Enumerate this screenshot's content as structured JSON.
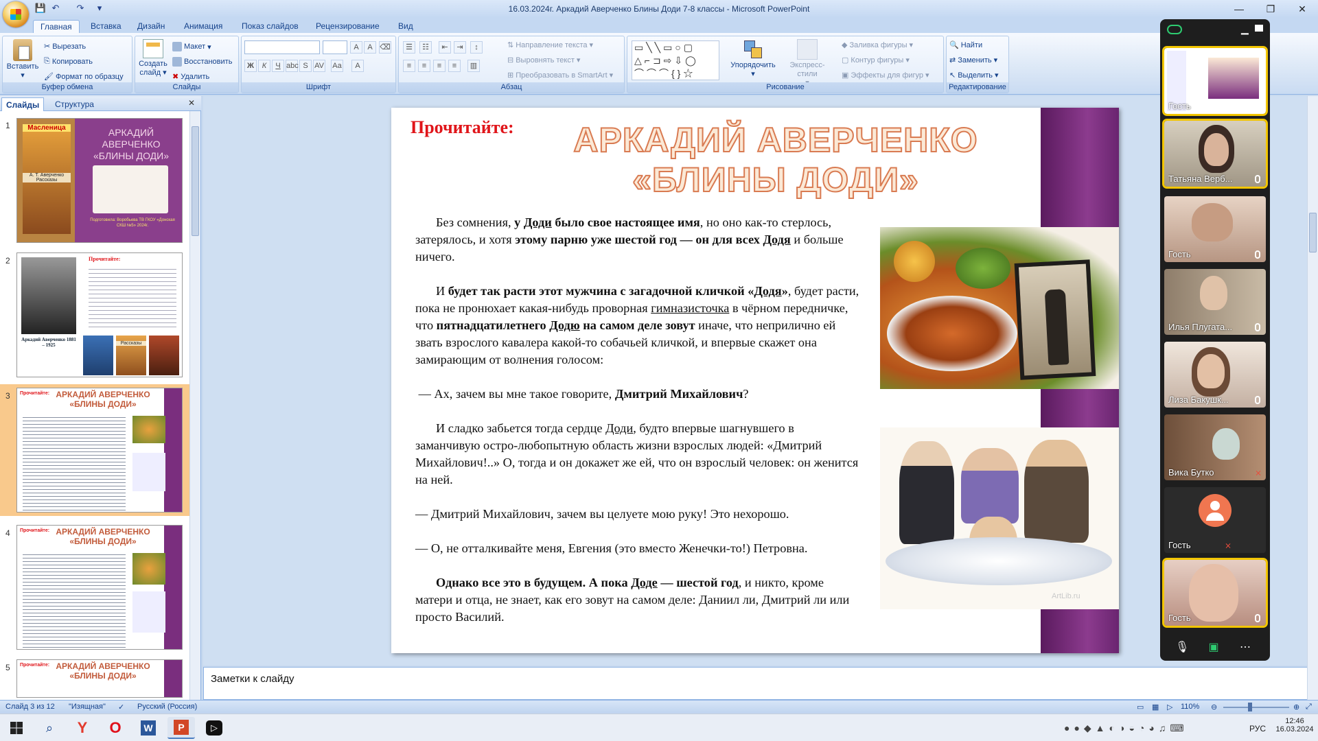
{
  "window": {
    "title": "16.03.2024г. Аркадий Аверченко Блины Доди 7-8 классы - Microsoft PowerPoint"
  },
  "ribbon_tabs": [
    "Главная",
    "Вставка",
    "Дизайн",
    "Анимация",
    "Показ слайдов",
    "Рецензирование",
    "Вид"
  ],
  "clipboard": {
    "paste": "Вставить",
    "cut": "Вырезать",
    "copy": "Копировать",
    "format": "Формат по образцу",
    "label": "Буфер обмена"
  },
  "slides_group": {
    "create": "Создать слайд",
    "layout": "Макет",
    "reset": "Восстановить",
    "delete": "Удалить",
    "label": "Слайды"
  },
  "font_group": {
    "label": "Шрифт"
  },
  "paragraph_group": {
    "direction": "Направление текста",
    "align": "Выровнять текст",
    "smartart": "Преобразовать в SmartArt",
    "label": "Абзац"
  },
  "drawing_group": {
    "arrange": "Упорядочить",
    "quick": "Экспресс-стили",
    "fill": "Заливка фигуры",
    "outline": "Контур фигуры",
    "effects": "Эффекты для фигур",
    "label": "Рисование"
  },
  "editing_group": {
    "find": "Найти",
    "replace": "Заменить",
    "select": "Выделить",
    "label": "Редактирование"
  },
  "pane_tabs": {
    "slides": "Слайды",
    "outline": "Структура"
  },
  "thumbs": [
    {
      "num": "1",
      "title": "АРКАДИЙ АВЕРЧЕНКО «БЛИНЫ ДОДИ»",
      "caption": "Масленица",
      "book": "А. Т. Аверченко Рассказы",
      "author": "Подготовила: Воробьева ТВ ГКОУ «Донская СКШ №5» 2024г."
    },
    {
      "num": "2",
      "title": "Прочитайте:",
      "caption": "Аркадий Аверченко 1881 – 1925",
      "book": "Рассказы"
    },
    {
      "num": "3",
      "title": "АРКАДИЙ АВЕРЧЕНКО «БЛИНЫ ДОДИ»",
      "caption": "Прочитайте:"
    },
    {
      "num": "4",
      "title": "АРКАДИЙ АВЕРЧЕНКО «БЛИНЫ ДОДИ»",
      "caption": "Прочитайте:"
    },
    {
      "num": "5",
      "title": "АРКАДИЙ АВЕРЧЕНКО «БЛИНЫ ДОДИ»",
      "caption": "Прочитайте:"
    }
  ],
  "slide": {
    "label": "Прочитайте:",
    "title_line1": "АРКАДИЙ АВЕРЧЕНКО",
    "title_line2": "«БЛИНЫ ДОДИ»",
    "watermark": "ArtLib.ru"
  },
  "notes_placeholder": "Заметки к слайду",
  "status": {
    "slide": "Слайд 3 из 12",
    "theme": "\"Изящная\"",
    "lang": "Русский (Россия)",
    "zoom": "110%"
  },
  "zoom_panel": {
    "participants": [
      {
        "name": "Гость",
        "speaking": true
      },
      {
        "name": "Татьяна Верб...",
        "speaking": true
      },
      {
        "name": "Гость",
        "speaking": false
      },
      {
        "name": "Илья Плугата...",
        "speaking": false
      },
      {
        "name": "Лиза Бакушк...",
        "speaking": false
      },
      {
        "name": "Вика Бутко",
        "speaking": false
      },
      {
        "name": "Гость",
        "speaking": false
      },
      {
        "name": "Гость",
        "speaking": true
      }
    ]
  },
  "taskbar": {
    "time": "12:46",
    "date": "16.03.2024",
    "lang": "РУС"
  },
  "colors": {
    "accent": "#15428b",
    "slide_purple": "#7a2e7e",
    "title_orange": "#d97b52",
    "label_red": "#e0151a"
  }
}
